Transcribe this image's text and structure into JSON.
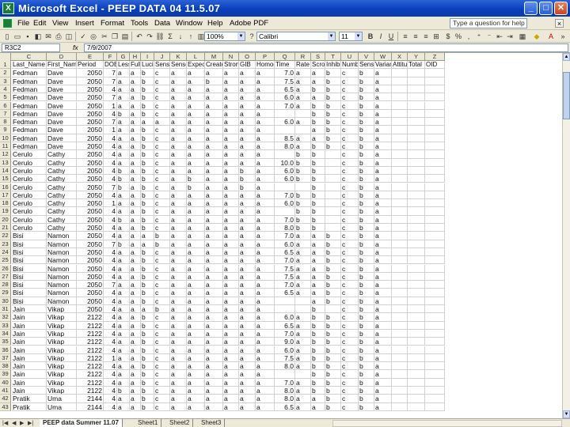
{
  "window": {
    "title": "Microsoft Excel - PEEP DATA 04 11.5.07",
    "app_icon": "X"
  },
  "menu": {
    "items": [
      "File",
      "Edit",
      "View",
      "Insert",
      "Format",
      "Tools",
      "Data",
      "Window",
      "Help",
      "Adobe PDF"
    ],
    "help_placeholder": "Type a question for help"
  },
  "toolbar": {
    "zoom": "100%",
    "font": "Calibri",
    "size": "11"
  },
  "formula_bar": {
    "name_box": "R3C2",
    "fx": "fx",
    "value": "7/9/2007"
  },
  "columns": [
    "C",
    "D",
    "E",
    "F",
    "G",
    "H",
    "I",
    "J",
    "K",
    "L",
    "M",
    "N",
    "O",
    "P",
    "Q",
    "R",
    "S",
    "T",
    "U",
    "V",
    "W",
    "X",
    "Y",
    "Z"
  ],
  "header_row": {
    "num": "1",
    "cells": [
      "Last_Name",
      "First_Name",
      "Period",
      "DOB",
      "Lesson",
      "Full",
      "Lucid",
      "Sense",
      "Sense",
      "Expect",
      "Create",
      "Strong",
      "GIB",
      "Homog",
      "Time",
      "Rate",
      "Scroll",
      "Inhibit",
      "Number",
      "Sense",
      "Variance",
      "Attitude",
      "Total",
      "OID"
    ]
  },
  "rows": [
    {
      "n": "2",
      "c": [
        "Fedman",
        "Dave",
        "2050",
        "7",
        "a",
        "a",
        "b",
        "c",
        "a",
        "a",
        "a",
        "a",
        "a",
        "a",
        "7.0",
        "a",
        "a",
        "b",
        "c",
        "b",
        "a",
        ""
      ]
    },
    {
      "n": "3",
      "c": [
        "Fedman",
        "Dave",
        "2050",
        "7",
        "a",
        "a",
        "b",
        "c",
        "a",
        "a",
        "b",
        "a",
        "a",
        "a",
        "7.5",
        "a",
        "a",
        "b",
        "c",
        "b",
        "a",
        ""
      ]
    },
    {
      "n": "4",
      "c": [
        "Fedman",
        "Dave",
        "2050",
        "4",
        "a",
        "a",
        "b",
        "c",
        "a",
        "a",
        "a",
        "a",
        "a",
        "a",
        "6.5",
        "a",
        "b",
        "b",
        "c",
        "b",
        "a",
        ""
      ]
    },
    {
      "n": "5",
      "c": [
        "Fedman",
        "Dave",
        "2050",
        "7",
        "a",
        "a",
        "b",
        "c",
        "a",
        "a",
        "a",
        "a",
        "a",
        "a",
        "6.0",
        "a",
        "a",
        "b",
        "c",
        "b",
        "a",
        ""
      ]
    },
    {
      "n": "6",
      "c": [
        "Fedman",
        "Dave",
        "2050",
        "1",
        "a",
        "a",
        "b",
        "c",
        "a",
        "a",
        "a",
        "a",
        "a",
        "a",
        "7.0",
        "a",
        "b",
        "b",
        "c",
        "b",
        "a",
        ""
      ]
    },
    {
      "n": "7",
      "c": [
        "Fedman",
        "Dave",
        "2050",
        "4",
        "b",
        "a",
        "b",
        "c",
        "a",
        "a",
        "a",
        "a",
        "a",
        "a",
        "",
        "",
        "b",
        "b",
        "c",
        "b",
        "a",
        ""
      ]
    },
    {
      "n": "8",
      "c": [
        "Fedman",
        "Dave",
        "2050",
        "7",
        "a",
        "a",
        "a",
        "a",
        "a",
        "a",
        "a",
        "a",
        "a",
        "a",
        "6.0",
        "a",
        "b",
        "b",
        "c",
        "b",
        "a",
        ""
      ]
    },
    {
      "n": "9",
      "c": [
        "Fedman",
        "Dave",
        "2050",
        "1",
        "a",
        "a",
        "b",
        "c",
        "a",
        "a",
        "a",
        "a",
        "a",
        "a",
        "",
        "",
        "a",
        "b",
        "c",
        "b",
        "a",
        ""
      ]
    },
    {
      "n": "10",
      "c": [
        "Fedman",
        "Dave",
        "2050",
        "4",
        "a",
        "a",
        "b",
        "c",
        "a",
        "a",
        "a",
        "a",
        "a",
        "a",
        "8.5",
        "a",
        "a",
        "b",
        "c",
        "b",
        "a",
        ""
      ]
    },
    {
      "n": "11",
      "c": [
        "Fedman",
        "Dave",
        "2050",
        "4",
        "a",
        "a",
        "b",
        "c",
        "a",
        "a",
        "a",
        "a",
        "a",
        "a",
        "8.0",
        "a",
        "b",
        "b",
        "c",
        "b",
        "a",
        ""
      ]
    },
    {
      "n": "12",
      "c": [
        "Cerulo",
        "Cathy",
        "2050",
        "4",
        "a",
        "a",
        "b",
        "c",
        "a",
        "a",
        "a",
        "a",
        "a",
        "a",
        "",
        "b",
        "b",
        "",
        "c",
        "b",
        "a",
        ""
      ]
    },
    {
      "n": "13",
      "c": [
        "Cerulo",
        "Cathy",
        "2050",
        "4",
        "a",
        "a",
        "b",
        "c",
        "a",
        "a",
        "a",
        "a",
        "a",
        "a",
        "10.0",
        "b",
        "b",
        "",
        "c",
        "b",
        "a",
        ""
      ]
    },
    {
      "n": "14",
      "c": [
        "Cerulo",
        "Cathy",
        "2050",
        "4",
        "b",
        "a",
        "b",
        "c",
        "a",
        "a",
        "a",
        "a",
        "b",
        "a",
        "6.0",
        "b",
        "b",
        "",
        "c",
        "b",
        "a",
        ""
      ]
    },
    {
      "n": "15",
      "c": [
        "Cerulo",
        "Cathy",
        "2050",
        "4",
        "b",
        "a",
        "b",
        "c",
        "a",
        "b",
        "a",
        "a",
        "b",
        "a",
        "6.0",
        "b",
        "b",
        "",
        "c",
        "b",
        "a",
        ""
      ]
    },
    {
      "n": "16",
      "c": [
        "Cerulo",
        "Cathy",
        "2050",
        "7",
        "b",
        "a",
        "b",
        "c",
        "a",
        "b",
        "a",
        "a",
        "b",
        "a",
        "",
        "",
        "b",
        "",
        "c",
        "b",
        "a",
        ""
      ]
    },
    {
      "n": "17",
      "c": [
        "Cerulo",
        "Cathy",
        "2050",
        "4",
        "a",
        "a",
        "b",
        "c",
        "a",
        "a",
        "a",
        "a",
        "a",
        "a",
        "7.0",
        "b",
        "b",
        "",
        "c",
        "b",
        "a",
        ""
      ]
    },
    {
      "n": "18",
      "c": [
        "Cerulo",
        "Cathy",
        "2050",
        "1",
        "a",
        "a",
        "b",
        "c",
        "a",
        "a",
        "a",
        "a",
        "a",
        "a",
        "6.0",
        "b",
        "b",
        "",
        "c",
        "b",
        "a",
        ""
      ]
    },
    {
      "n": "19",
      "c": [
        "Cerulo",
        "Cathy",
        "2050",
        "4",
        "a",
        "a",
        "b",
        "c",
        "a",
        "a",
        "a",
        "a",
        "a",
        "a",
        "",
        "b",
        "b",
        "",
        "c",
        "b",
        "a",
        ""
      ]
    },
    {
      "n": "20",
      "c": [
        "Cerulo",
        "Cathy",
        "2050",
        "4",
        "b",
        "a",
        "b",
        "c",
        "a",
        "a",
        "a",
        "a",
        "a",
        "a",
        "7.0",
        "b",
        "b",
        "",
        "c",
        "b",
        "a",
        ""
      ]
    },
    {
      "n": "21",
      "c": [
        "Cerulo",
        "Cathy",
        "2050",
        "4",
        "a",
        "a",
        "b",
        "c",
        "a",
        "a",
        "a",
        "a",
        "a",
        "a",
        "8.0",
        "b",
        "b",
        "",
        "c",
        "b",
        "a",
        ""
      ]
    },
    {
      "n": "22",
      "c": [
        "Bisi",
        "Namon",
        "2050",
        "4",
        "a",
        "a",
        "a",
        "b",
        "a",
        "a",
        "a",
        "a",
        "a",
        "a",
        "7.0",
        "a",
        "a",
        "b",
        "c",
        "b",
        "a",
        ""
      ]
    },
    {
      "n": "23",
      "c": [
        "Bisi",
        "Namon",
        "2050",
        "7",
        "b",
        "a",
        "a",
        "b",
        "a",
        "a",
        "a",
        "a",
        "a",
        "a",
        "6.0",
        "a",
        "a",
        "b",
        "c",
        "b",
        "a",
        ""
      ]
    },
    {
      "n": "24",
      "c": [
        "Bisi",
        "Namon",
        "2050",
        "4",
        "a",
        "a",
        "b",
        "c",
        "a",
        "a",
        "a",
        "a",
        "a",
        "a",
        "6.5",
        "a",
        "a",
        "b",
        "c",
        "b",
        "a",
        ""
      ]
    },
    {
      "n": "25",
      "c": [
        "Bisi",
        "Namon",
        "2050",
        "4",
        "a",
        "a",
        "b",
        "c",
        "a",
        "a",
        "a",
        "a",
        "a",
        "a",
        "7.0",
        "a",
        "a",
        "b",
        "c",
        "b",
        "a",
        ""
      ]
    },
    {
      "n": "26",
      "c": [
        "Bisi",
        "Namon",
        "2050",
        "4",
        "a",
        "a",
        "b",
        "c",
        "a",
        "a",
        "a",
        "a",
        "a",
        "a",
        "7.5",
        "a",
        "a",
        "b",
        "c",
        "b",
        "a",
        ""
      ]
    },
    {
      "n": "27",
      "c": [
        "Bisi",
        "Namon",
        "2050",
        "4",
        "a",
        "a",
        "b",
        "c",
        "a",
        "a",
        "a",
        "a",
        "a",
        "a",
        "7.5",
        "a",
        "a",
        "b",
        "c",
        "b",
        "a",
        ""
      ]
    },
    {
      "n": "28",
      "c": [
        "Bisi",
        "Namon",
        "2050",
        "7",
        "a",
        "a",
        "b",
        "c",
        "a",
        "a",
        "a",
        "a",
        "a",
        "a",
        "7.0",
        "a",
        "a",
        "b",
        "c",
        "b",
        "a",
        ""
      ]
    },
    {
      "n": "29",
      "c": [
        "Bisi",
        "Namon",
        "2050",
        "4",
        "a",
        "a",
        "b",
        "c",
        "a",
        "a",
        "a",
        "a",
        "a",
        "a",
        "6.5",
        "a",
        "a",
        "b",
        "c",
        "b",
        "a",
        ""
      ]
    },
    {
      "n": "30",
      "c": [
        "Bisi",
        "Namon",
        "2050",
        "4",
        "a",
        "a",
        "b",
        "c",
        "a",
        "a",
        "a",
        "a",
        "a",
        "a",
        "",
        "",
        "a",
        "b",
        "c",
        "b",
        "a",
        ""
      ]
    },
    {
      "n": "31",
      "c": [
        "Jain",
        "Vikap",
        "2050",
        "4",
        "a",
        "a",
        "a",
        "b",
        "a",
        "a",
        "a",
        "a",
        "a",
        "a",
        "",
        "",
        "b",
        "",
        "c",
        "b",
        "a",
        ""
      ]
    },
    {
      "n": "32",
      "c": [
        "Jain",
        "Vikap",
        "2122",
        "4",
        "a",
        "a",
        "b",
        "c",
        "a",
        "a",
        "a",
        "a",
        "a",
        "a",
        "6.0",
        "a",
        "b",
        "b",
        "c",
        "b",
        "a",
        ""
      ]
    },
    {
      "n": "33",
      "c": [
        "Jain",
        "Vikap",
        "2122",
        "4",
        "a",
        "a",
        "b",
        "c",
        "a",
        "a",
        "a",
        "a",
        "a",
        "a",
        "6.5",
        "a",
        "b",
        "b",
        "c",
        "b",
        "a",
        ""
      ]
    },
    {
      "n": "34",
      "c": [
        "Jain",
        "Vikap",
        "2122",
        "4",
        "a",
        "a",
        "b",
        "c",
        "a",
        "a",
        "a",
        "a",
        "a",
        "a",
        "7.0",
        "a",
        "b",
        "b",
        "c",
        "b",
        "a",
        ""
      ]
    },
    {
      "n": "35",
      "c": [
        "Jain",
        "Vikap",
        "2122",
        "4",
        "a",
        "a",
        "b",
        "c",
        "a",
        "a",
        "a",
        "a",
        "a",
        "a",
        "9.0",
        "a",
        "b",
        "b",
        "c",
        "b",
        "a",
        ""
      ]
    },
    {
      "n": "36",
      "c": [
        "Jain",
        "Vikap",
        "2122",
        "4",
        "a",
        "a",
        "b",
        "c",
        "a",
        "a",
        "a",
        "a",
        "a",
        "a",
        "6.0",
        "a",
        "b",
        "b",
        "c",
        "b",
        "a",
        ""
      ]
    },
    {
      "n": "37",
      "c": [
        "Jain",
        "Vikap",
        "2122",
        "1",
        "a",
        "a",
        "b",
        "c",
        "a",
        "a",
        "a",
        "a",
        "a",
        "a",
        "7.5",
        "a",
        "b",
        "b",
        "c",
        "b",
        "a",
        ""
      ]
    },
    {
      "n": "38",
      "c": [
        "Jain",
        "Vikap",
        "2122",
        "4",
        "a",
        "a",
        "b",
        "c",
        "a",
        "a",
        "a",
        "a",
        "a",
        "a",
        "8.0",
        "a",
        "b",
        "b",
        "c",
        "b",
        "a",
        ""
      ]
    },
    {
      "n": "39",
      "c": [
        "Jain",
        "Vikap",
        "2122",
        "4",
        "a",
        "a",
        "b",
        "c",
        "a",
        "a",
        "a",
        "a",
        "a",
        "a",
        "",
        "",
        "b",
        "b",
        "c",
        "b",
        "a",
        ""
      ]
    },
    {
      "n": "40",
      "c": [
        "Jain",
        "Vikap",
        "2122",
        "4",
        "a",
        "a",
        "b",
        "c",
        "a",
        "a",
        "a",
        "a",
        "a",
        "a",
        "7.0",
        "a",
        "b",
        "b",
        "c",
        "b",
        "a",
        ""
      ]
    },
    {
      "n": "41",
      "c": [
        "Jain",
        "Vikap",
        "2122",
        "4",
        "b",
        "a",
        "b",
        "c",
        "a",
        "a",
        "a",
        "a",
        "a",
        "a",
        "8.0",
        "a",
        "b",
        "b",
        "c",
        "b",
        "a",
        ""
      ]
    },
    {
      "n": "42",
      "c": [
        "Pratik",
        "Uma",
        "2144",
        "4",
        "a",
        "a",
        "b",
        "c",
        "a",
        "a",
        "a",
        "a",
        "a",
        "a",
        "8.0",
        "a",
        "a",
        "b",
        "c",
        "b",
        "a",
        ""
      ]
    },
    {
      "n": "43",
      "c": [
        "Pratik",
        "Uma",
        "2144",
        "4",
        "a",
        "a",
        "b",
        "c",
        "a",
        "a",
        "a",
        "a",
        "a",
        "a",
        "6.5",
        "a",
        "a",
        "b",
        "c",
        "b",
        "a",
        ""
      ]
    }
  ],
  "sheet_tabs": [
    "PEEP data Summer 11.07",
    "Sheet1",
    "Sheet2",
    "Sheet3"
  ]
}
